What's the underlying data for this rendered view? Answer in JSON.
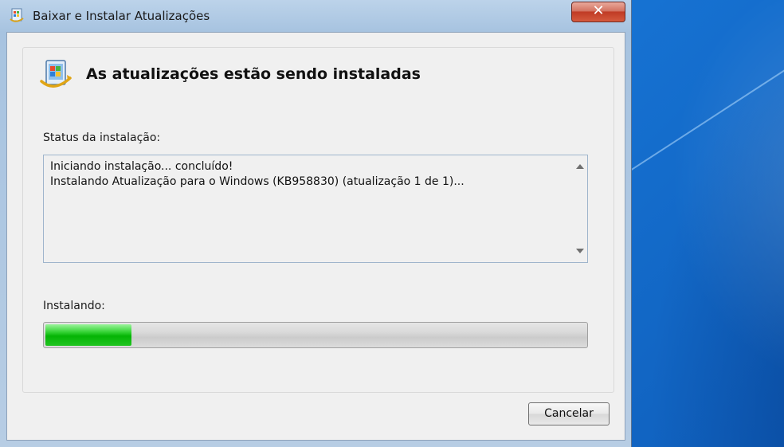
{
  "window": {
    "title": "Baixar e Instalar Atualizações",
    "close_label": "✕"
  },
  "header": {
    "title": "As atualizações estão sendo instaladas",
    "icon": "windows-update-icon"
  },
  "status": {
    "label": "Status da instalação:",
    "log_lines": [
      "Iniciando instalação... concluído!",
      "Instalando Atualização para o Windows (KB958830) (atualização 1 de 1)..."
    ]
  },
  "progress": {
    "label": "Instalando:",
    "value_percent": 16,
    "color": "#0db50d"
  },
  "buttons": {
    "cancel_label": "Cancelar"
  },
  "colors": {
    "desktop": "#1877d8",
    "window_frame": "#a7c3e0",
    "client_bg": "#f0f0f0",
    "close_button": "#c03b25"
  }
}
